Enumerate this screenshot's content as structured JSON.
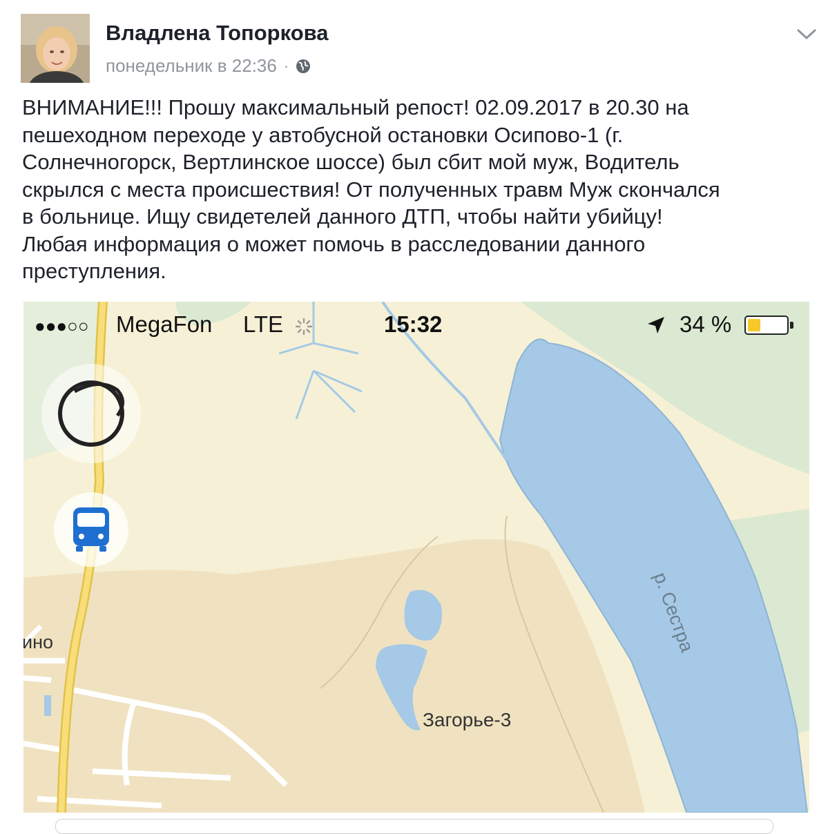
{
  "post": {
    "author": "Владлена Топоркова",
    "timestamp": "понедельник в 22:36",
    "separator": "·",
    "privacy_icon": "globe-icon",
    "menu_icon": "chevron-down-icon",
    "text_lines": [
      "ВНИМАНИЕ!!! Прошу максимальный репост!  02.09.2017 в 20.30 на",
      "пешеходном переходе у автобусной остановки Осипово-1 (г.",
      "Солнечногорск, Вертлинское шоссе) был сбит мой муж, Водитель",
      "скрылся с места происшествия! От полученных травм Муж скончался",
      "в больнице. Ищу свидетелей данного ДТП, чтобы найти убийцу!",
      "Любая информация о может помочь в расследовании данного",
      "преступления."
    ]
  },
  "screenshot": {
    "status_bar": {
      "signal": "●●●○○",
      "carrier": "MegaFon",
      "network": "LTE",
      "activity_icon": "spinner-icon",
      "time": "15:32",
      "location_icon": "location-arrow-icon",
      "battery": "34 %",
      "battery_level": 0.34
    },
    "map": {
      "labels": {
        "village_partial": "ино",
        "village": "Загорье-3",
        "river": "р. Сестра"
      },
      "colors": {
        "land": "#f6f1d6",
        "urban": "#f0e2c0",
        "forest": "#dbe9d2",
        "water": "#a5c9e6",
        "road": "#f5d66a"
      }
    },
    "buttons": {
      "layers_icon": "layers-icon",
      "transport_icon": "bus-icon"
    }
  }
}
